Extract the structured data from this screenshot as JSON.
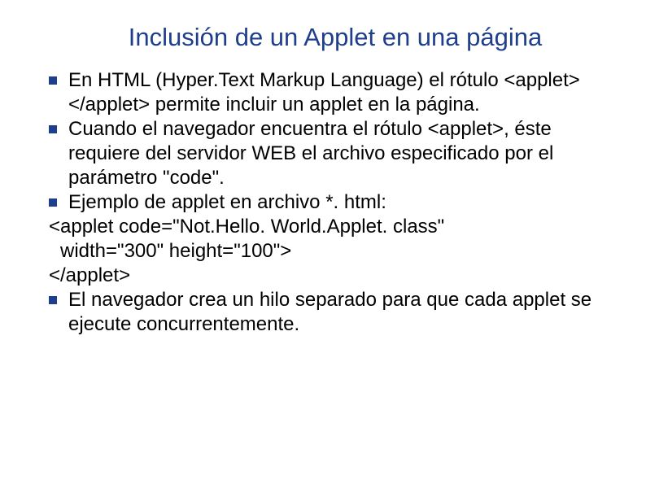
{
  "slide": {
    "title": "Inclusión de un Applet en una página",
    "items": [
      {
        "type": "bullet",
        "text": "En HTML (Hyper.Text Markup Language) el rótulo <applet></applet> permite incluir un applet en la página."
      },
      {
        "type": "bullet",
        "text": "Cuando el navegador encuentra el rótulo <applet>, éste requiere del servidor WEB el archivo especificado por el parámetro \"code\"."
      },
      {
        "type": "bullet",
        "text": "Ejemplo de applet en archivo *. html:"
      },
      {
        "type": "plain",
        "text": "<applet code=\"Not.Hello. World.Applet. class\""
      },
      {
        "type": "indent",
        "text": "width=\"300\" height=\"100\">"
      },
      {
        "type": "plain",
        "text": "</applet>"
      },
      {
        "type": "bullet",
        "text": "El navegador crea un hilo separado para que cada applet se ejecute concurrentemente."
      }
    ]
  }
}
